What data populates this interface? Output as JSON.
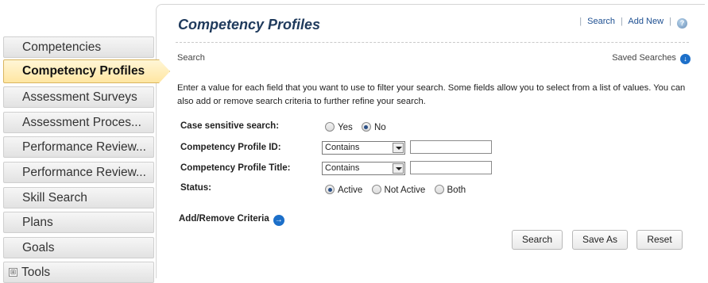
{
  "sidebar": {
    "items": [
      {
        "label": "Competencies"
      },
      {
        "label": "Competency Profiles"
      },
      {
        "label": "Assessment Surveys"
      },
      {
        "label": "Assessment Proces..."
      },
      {
        "label": "Performance Review..."
      },
      {
        "label": "Performance Review..."
      },
      {
        "label": "Skill Search"
      },
      {
        "label": "Plans"
      },
      {
        "label": "Goals"
      },
      {
        "label": "Tools"
      }
    ],
    "active_index": 1,
    "tools_toggle_symbol": "⊞"
  },
  "header": {
    "title": "Competency Profiles",
    "links": {
      "search": "Search",
      "add_new": "Add New",
      "separator": "|"
    },
    "help_icon": "question-mark",
    "help_symbol": "?"
  },
  "search": {
    "section_label": "Search",
    "saved_searches": "Saved Searches",
    "saved_searches_icon": "arrow-down-circle",
    "description": "Enter a value for each field that you want to use to filter your search. Some fields allow you to select from a list of values. You can also add or remove search criteria to further refine your search.",
    "case_sensitive": {
      "label": "Case sensitive search:",
      "options": [
        "Yes",
        "No"
      ],
      "selected": "No"
    },
    "profile_id": {
      "label": "Competency Profile ID:",
      "operator": "Contains",
      "value": ""
    },
    "profile_title": {
      "label": "Competency Profile Title:",
      "operator": "Contains",
      "value": ""
    },
    "status": {
      "label": "Status:",
      "options": [
        "Active",
        "Not Active",
        "Both"
      ],
      "selected": "Active"
    },
    "add_remove_criteria": "Add/Remove Criteria",
    "add_remove_icon": "arrow-right-circle"
  },
  "buttons": {
    "search": "Search",
    "save_as": "Save As",
    "reset": "Reset"
  },
  "colors": {
    "title": "#1f3a5c",
    "link": "#1d4f91",
    "active_tab": "#ffe6a2",
    "icon_blue": "#1c6fc9"
  }
}
